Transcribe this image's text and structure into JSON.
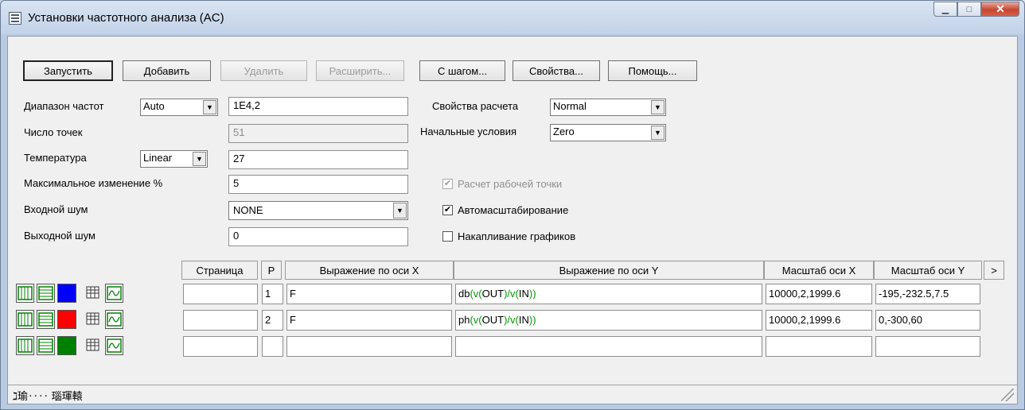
{
  "window": {
    "title": "Установки частотного анализа (AC)"
  },
  "toolbar": {
    "run": "Запустить",
    "add": "Добавить",
    "delete": "Удалить",
    "expand": "Расширить...",
    "step": "С шагом...",
    "properties": "Свойства...",
    "help": "Помощь..."
  },
  "form": {
    "freq_range_label": "Диапазон частот",
    "freq_range_mode": "Auto",
    "freq_range_value": "1E4,2",
    "points_label": "Число точек",
    "points_value": "51",
    "temperature_label": "Температура",
    "temperature_mode": "Linear",
    "temperature_value": "27",
    "max_change_label": "Максимальное изменение %",
    "max_change_value": "5",
    "input_noise_label": "Входной шум",
    "input_noise_value": "NONE",
    "output_noise_label": "Выходной шум",
    "output_noise_value": "0",
    "calc_props_label": "Свойства расчета",
    "calc_props_value": "Normal",
    "init_cond_label": "Начальные условия",
    "init_cond_value": "Zero",
    "operating_point_label": "Расчет рабочей точки",
    "operating_point_checked": true,
    "autoscale_label": "Автомасштабирование",
    "autoscale_checked": true,
    "accumulate_label": "Накапливание графиков",
    "accumulate_checked": false
  },
  "table": {
    "headers": {
      "page": "Страница",
      "p": "P",
      "x_expr": "Выражение по оси X",
      "y_expr": "Выражение по оси Y",
      "x_scale": "Масштаб оси X",
      "y_scale": "Масштаб оси Y",
      "more": ">"
    },
    "rows": [
      {
        "color": "#0000ff",
        "page": "",
        "p": "1",
        "x_expr": "F",
        "y_expr_pre": "db",
        "y_expr_fn": "(v(",
        "y_expr_mid": "OUT",
        "y_expr_fn2": ")/v(",
        "y_expr_arg2": "IN",
        "y_expr_end": "))",
        "x_scale": "10000,2,1999.6",
        "y_scale": "-195,-232.5,7.5"
      },
      {
        "color": "#ff0000",
        "page": "",
        "p": "2",
        "x_expr": "F",
        "y_expr_pre": "ph",
        "y_expr_fn": "(v(",
        "y_expr_mid": "OUT",
        "y_expr_fn2": ")/v(",
        "y_expr_arg2": "IN",
        "y_expr_end": "))",
        "x_scale": "10000,2,1999.6",
        "y_scale": "0,-300,60"
      },
      {
        "color": "#008000",
        "page": "",
        "p": "",
        "x_expr": "",
        "y_expr_pre": "",
        "y_expr_fn": "",
        "y_expr_mid": "",
        "y_expr_fn2": "",
        "y_expr_arg2": "",
        "y_expr_end": "",
        "x_scale": "",
        "y_scale": ""
      }
    ]
  },
  "status_text": "ℷ瑜‥‥ 瑙琿轅"
}
